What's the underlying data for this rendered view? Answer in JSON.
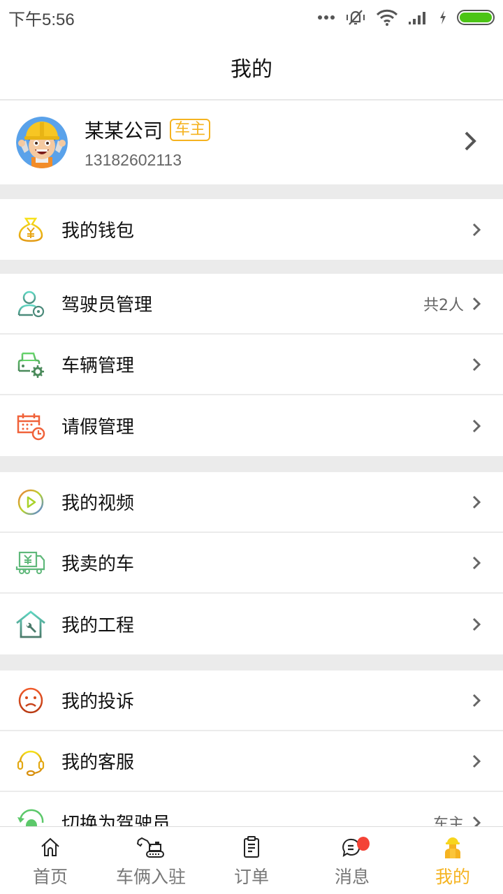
{
  "status_bar": {
    "time": "下午5:56",
    "icons": [
      "more-dots-icon",
      "mute-icon",
      "wifi-icon",
      "signal-icon",
      "charging-icon",
      "battery-icon"
    ],
    "battery_color": "#4cc416"
  },
  "header": {
    "title": "我的"
  },
  "profile": {
    "name": "某某公司",
    "role_badge": "车主",
    "phone": "13182602113",
    "badge_color": "#f5b320"
  },
  "groups": [
    {
      "items": [
        {
          "label": "我的钱包",
          "icon": "wallet-icon"
        }
      ]
    },
    {
      "items": [
        {
          "label": "驾驶员管理",
          "icon": "driver-icon",
          "extra": "共2人"
        },
        {
          "label": "车辆管理",
          "icon": "vehicle-settings-icon"
        },
        {
          "label": "请假管理",
          "icon": "leave-calendar-icon"
        }
      ]
    },
    {
      "items": [
        {
          "label": "我的视频",
          "icon": "video-play-icon"
        },
        {
          "label": "我卖的车",
          "icon": "sell-truck-icon"
        },
        {
          "label": "我的工程",
          "icon": "project-house-icon"
        }
      ]
    },
    {
      "items": [
        {
          "label": "我的投诉",
          "icon": "complaint-face-icon"
        },
        {
          "label": "我的客服",
          "icon": "headset-icon"
        },
        {
          "label": "切换为驾驶员",
          "icon": "switch-role-icon",
          "extra": "车主"
        }
      ]
    }
  ],
  "tab_bar": {
    "active_color": "#f5b320",
    "tabs": [
      {
        "label": "首页",
        "icon": "home-icon"
      },
      {
        "label": "车俩入驻",
        "icon": "excavator-icon"
      },
      {
        "label": "订单",
        "icon": "clipboard-icon"
      },
      {
        "label": "消息",
        "icon": "chat-icon",
        "has_badge": true
      },
      {
        "label": "我的",
        "icon": "worker-icon",
        "active": true
      }
    ]
  }
}
